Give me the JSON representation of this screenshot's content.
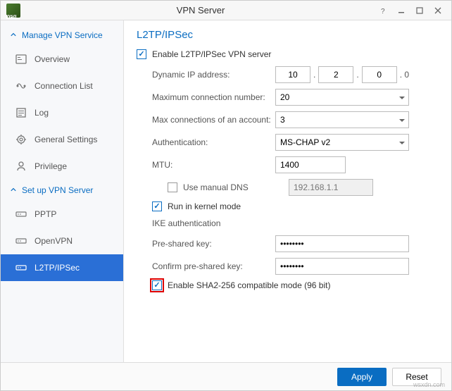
{
  "window": {
    "title": "VPN Server"
  },
  "sidebar": {
    "sections": [
      {
        "label": "Manage VPN Service",
        "items": [
          {
            "icon": "overview-icon",
            "label": "Overview"
          },
          {
            "icon": "connection-icon",
            "label": "Connection List"
          },
          {
            "icon": "log-icon",
            "label": "Log"
          },
          {
            "icon": "settings-icon",
            "label": "General Settings"
          },
          {
            "icon": "privilege-icon",
            "label": "Privilege"
          }
        ]
      },
      {
        "label": "Set up VPN Server",
        "items": [
          {
            "icon": "pptp-icon",
            "label": "PPTP"
          },
          {
            "icon": "openvpn-icon",
            "label": "OpenVPN"
          },
          {
            "icon": "l2tp-icon",
            "label": "L2TP/IPSec"
          }
        ]
      }
    ]
  },
  "main": {
    "title": "L2TP/IPSec",
    "enable_label": "Enable L2TP/IPSec VPN server",
    "dynamic_ip_label": "Dynamic IP address:",
    "ip": {
      "a": "10",
      "b": "2",
      "c": "0",
      "suffix": ". 0"
    },
    "max_conn_label": "Maximum connection number:",
    "max_conn_value": "20",
    "max_acct_label": "Max connections of an account:",
    "max_acct_value": "3",
    "auth_label": "Authentication:",
    "auth_value": "MS-CHAP v2",
    "mtu_label": "MTU:",
    "mtu_value": "1400",
    "manual_dns_label": "Use manual DNS",
    "manual_dns_placeholder": "192.168.1.1",
    "kernel_mode_label": "Run in kernel mode",
    "ike_label": "IKE authentication",
    "psk_label": "Pre-shared key:",
    "psk_value": "••••••••",
    "confirm_psk_label": "Confirm pre-shared key:",
    "confirm_psk_value": "••••••••",
    "sha2_label": "Enable SHA2-256 compatible mode (96 bit)"
  },
  "footer": {
    "apply": "Apply",
    "reset": "Reset"
  },
  "watermark": "wsxdn.com"
}
